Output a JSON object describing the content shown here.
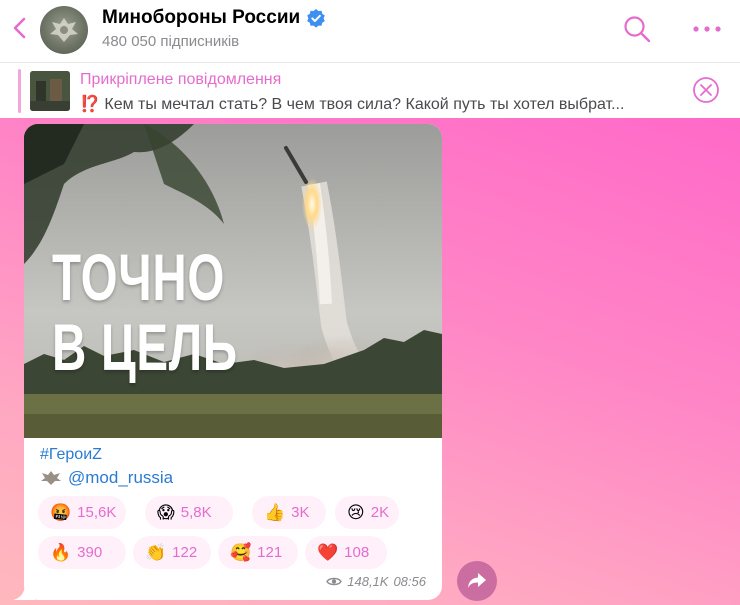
{
  "header": {
    "channel_name": "Минобороны России",
    "subscribers": "480 050 підписників"
  },
  "pinned": {
    "title": "Прикріплене повідомлення",
    "text": "⁉️ Кем ты мечтал стать? В чем твоя сила? Какой путь ты хотел выбрат..."
  },
  "message": {
    "image_headline_line1": "ТОЧНО",
    "image_headline_line2": "В ЦЕЛЬ",
    "hashtag": "#ГероиZ",
    "mention": "@mod_russia",
    "reactions": [
      {
        "emoji": "🤬",
        "count": "15,6K"
      },
      {
        "emoji": "😱",
        "count": "5,8K"
      },
      {
        "emoji": "👍",
        "count": "3K"
      },
      {
        "emoji": "😢",
        "count": "2K"
      },
      {
        "emoji": "🔥",
        "count": "390"
      },
      {
        "emoji": "👏",
        "count": "122"
      },
      {
        "emoji": "🥰",
        "count": "121"
      },
      {
        "emoji": "❤️",
        "count": "108"
      }
    ],
    "views": "148,1K",
    "time": "08:56"
  },
  "colors": {
    "accent": "#e56cce",
    "link": "#2b7bd3",
    "verified": "#3d8ff2"
  }
}
